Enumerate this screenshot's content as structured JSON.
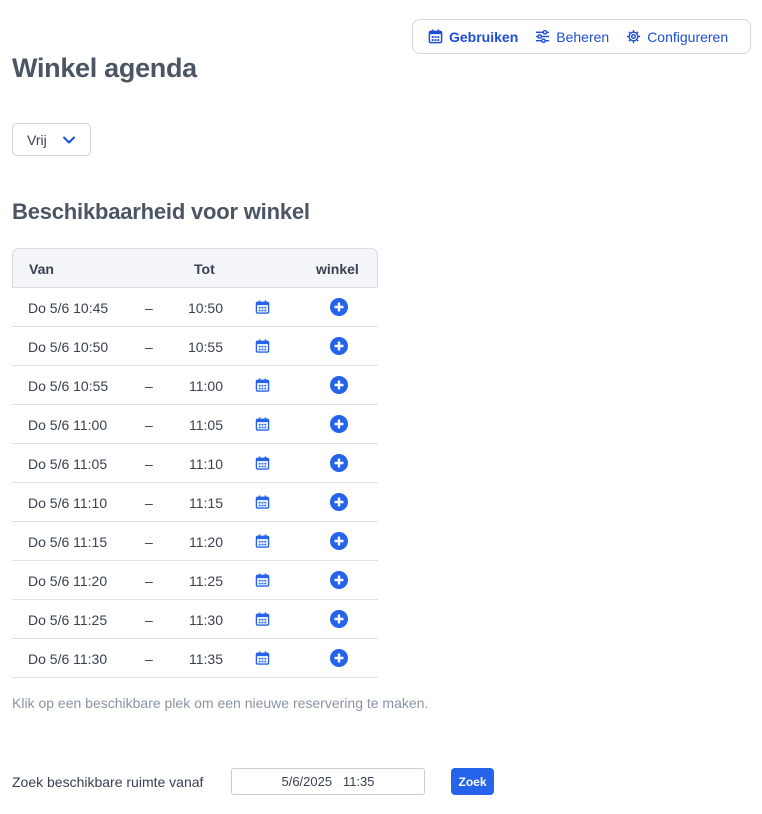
{
  "nav": {
    "items": [
      {
        "label": "Gebruiken",
        "icon": "calendar-icon",
        "active": true
      },
      {
        "label": "Beheren",
        "icon": "sliders-icon",
        "active": false
      },
      {
        "label": "Configureren",
        "icon": "gear-icon",
        "active": false
      }
    ]
  },
  "page": {
    "title": "Winkel agenda",
    "filter_value": "Vrij",
    "availability_heading": "Beschikbaarheid voor winkel"
  },
  "table": {
    "headers": {
      "van": "Van",
      "tot": "Tot",
      "winkel": "winkel"
    },
    "dash": "–",
    "rows": [
      {
        "van": "Do 5/6 10:45",
        "tot": "10:50"
      },
      {
        "van": "Do 5/6 10:50",
        "tot": "10:55"
      },
      {
        "van": "Do 5/6 10:55",
        "tot": "11:00"
      },
      {
        "van": "Do 5/6 11:00",
        "tot": "11:05"
      },
      {
        "van": "Do 5/6 11:05",
        "tot": "11:10"
      },
      {
        "van": "Do 5/6 11:10",
        "tot": "11:15"
      },
      {
        "van": "Do 5/6 11:15",
        "tot": "11:20"
      },
      {
        "van": "Do 5/6 11:20",
        "tot": "11:25"
      },
      {
        "van": "Do 5/6 11:25",
        "tot": "11:30"
      },
      {
        "van": "Do 5/6 11:30",
        "tot": "11:35"
      }
    ]
  },
  "hint": "Klik op een beschikbare plek om een nieuwe reservering te maken.",
  "search": {
    "label": "Zoek beschikbare ruimte vanaf",
    "value": "5/6/2025   11:35",
    "button": "Zoek"
  },
  "colors": {
    "accent": "#2563eb",
    "link": "#1d4ed8",
    "header_bg": "#f3f5f8"
  }
}
